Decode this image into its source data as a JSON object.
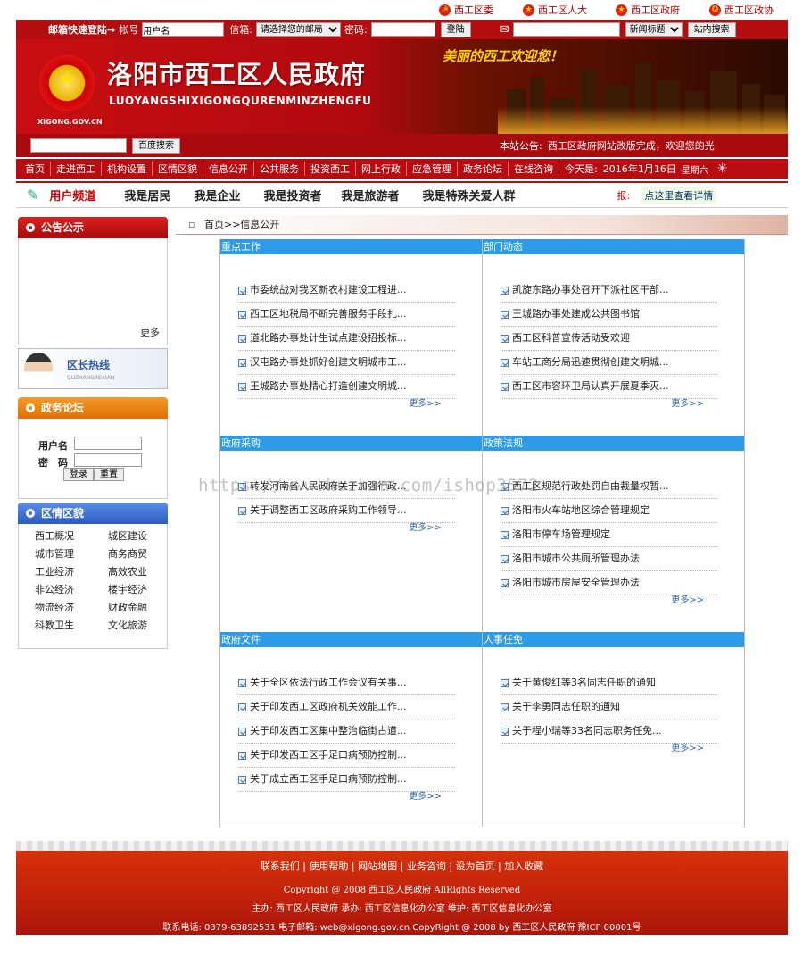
{
  "toplinks": [
    "西工区委",
    "西工区人大",
    "西工区政府",
    "西工区政协"
  ],
  "login": {
    "title": "邮箱快速登陆→",
    "account_label": "帐号",
    "account_value": "用户名",
    "mailbox_label": "信箱:",
    "mailbox_select": "请选择您的邮局",
    "password_label": "密码:",
    "login_button": "登陆",
    "search_select": "新闻标题",
    "site_search_button": "站内搜索"
  },
  "banner": {
    "domain": "XIGONG.GOV.CN",
    "title": "洛阳市西工区人民政府",
    "pinyin": "LUOYANGSHIXIGONGQURENMINZHENGFU",
    "welcome": "美丽的西工欢迎您！"
  },
  "searchbar": {
    "baidu_button": "百度搜索",
    "notice_label": "本站公告:",
    "notice_text": "西工区政府网站改版完成，欢迎您的光"
  },
  "nav": {
    "items": [
      "首页",
      "走进西工",
      "机构设置",
      "区情区貌",
      "信息公开",
      "公共服务",
      "投资西工",
      "网上行政",
      "应急管理",
      "政务论坛",
      "在线咨询"
    ],
    "date_label": "今天是:",
    "date": "2016年1月16日",
    "weekday": "星期六"
  },
  "channels": {
    "user_channel": "用户频道",
    "items": [
      "我是居民",
      "我是企业",
      "我是投资者",
      "我是旅游者",
      "我是特殊关爱人群"
    ],
    "report_label": "报:",
    "report_link": "点这里查看详情"
  },
  "sidebar": {
    "notice_title": "公告公示",
    "notice_more": "更多",
    "hotline_title": "区长热线",
    "hotline_sub": "QUZHANGREXIAN",
    "forum_title": "政务论坛",
    "username_label": "用户名",
    "password_label": "密　码",
    "login_button": "登录",
    "reset_button": "重置",
    "region_title": "区情区貌",
    "region_items": [
      "西工概况",
      "城区建设",
      "城市管理",
      "商务商贸",
      "工业经济",
      "高效农业",
      "非公经济",
      "楼宇经济",
      "物流经济",
      "财政金融",
      "科教卫生",
      "文化旅游"
    ]
  },
  "breadcrumb": "首页>>信息公开",
  "more_label": "更多>>",
  "panels": [
    {
      "title": "重点工作",
      "items": [
        "市委统战对我区新农村建设工程进...",
        "西工区地税局不断完善服务手段扎...",
        "道北路办事处计生试点建设招投标...",
        "汉屯路办事处抓好创建文明城市工...",
        "王城路办事处精心打造创建文明城..."
      ]
    },
    {
      "title": "部门动态",
      "items": [
        "凯旋东路办事处召开下派社区干部...",
        "王城路办事处建成公共图书馆",
        "西工区科普宣传活动受欢迎",
        "车站工商分局迅速贯彻创建文明城...",
        "西工区市容环卫局认真开展夏季灭..."
      ]
    },
    {
      "title": "政府采购",
      "items": [
        "转发河南省人民政府关于加强行政...",
        "关于调整西工区政府采购工作领导..."
      ]
    },
    {
      "title": "政策法规",
      "items": [
        "西工区规范行政处罚自由裁量权暂...",
        "洛阳市火车站地区综合管理规定",
        "洛阳市停车场管理规定",
        "洛阳市城市公共厕所管理办法",
        "洛阳市城市房屋安全管理办法"
      ]
    },
    {
      "title": "政府文件",
      "items": [
        "关于全区依法行政工作会议有关事...",
        "关于印发西工区政府机关效能工作...",
        "关于印发西工区集中整治临街占道...",
        "关于印发西工区手足口病预防控制...",
        "关于成立西工区手足口病预防控制..."
      ]
    },
    {
      "title": "人事任免",
      "items": [
        "关于黄俊红等3名同志任职的通知",
        "关于李勇同志任职的通知",
        "关于程小瑞等33名同志职务任免..."
      ]
    }
  ],
  "watermark": "https://www.huzhan.com/ishop3572",
  "footer": {
    "links": [
      "联系我们",
      "使用帮助",
      "网站地图",
      "业务咨询",
      "设为首页",
      "加入收藏"
    ],
    "copyright": "Copyright @ 2008 西工区人民政府 AllRights Reserved",
    "sponsor": "主办: 西工区人民政府 承办: 西工区信息化办公室 维护: 西工区信息化办公室",
    "contact": "联系电话: 0379-63892531 电子邮箱: web@xigong.gov.cn CopyRight @ 2008 by 西工区人民政府 豫ICP 00001号"
  },
  "colors": {
    "brand_red": "#b70c10",
    "panel_blue": "#2d9be8",
    "footer_red": "#c0200a"
  }
}
